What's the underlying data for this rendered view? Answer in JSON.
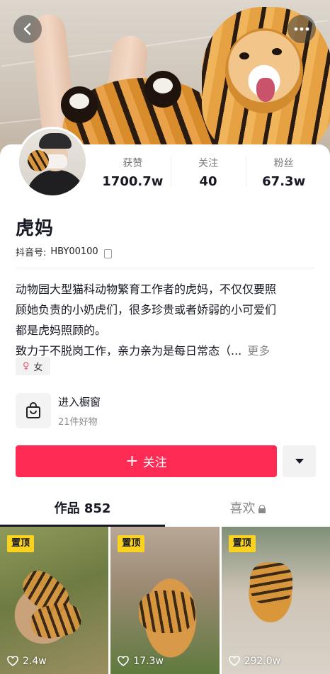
{
  "header": {
    "back_icon": "chevron-left-icon",
    "more_icon": "more-dots-icon"
  },
  "profile": {
    "name": "虎妈",
    "douyin_id_label": "抖音号:",
    "douyin_id": "HBY00100",
    "stats": [
      {
        "label": "获赞",
        "value": "1700.7w"
      },
      {
        "label": "关注",
        "value": "40"
      },
      {
        "label": "粉丝",
        "value": "67.3w"
      }
    ],
    "bio_lines": [
      "动物园大型猫科动物繁育工作者的虎妈，不仅仅要照",
      "顾她负责的小奶虎们，很多珍贵或者娇弱的小可爱们",
      "都是虎妈照顾的。",
      "致力于不脱岗工作，亲力亲为是每日常态（..."
    ],
    "bio_more": "更多",
    "gender_symbol": "♀",
    "gender": "女"
  },
  "shop": {
    "title": "进入橱窗",
    "subtitle": "21件好物"
  },
  "actions": {
    "follow_label": "关注",
    "follow_icon": "+",
    "accent_color": "#fe2c55"
  },
  "tabs": [
    {
      "label": "作品 852"
    },
    {
      "label": "喜欢"
    }
  ],
  "videos": [
    {
      "badge": "置顶",
      "likes": "2.4w"
    },
    {
      "badge": "置顶",
      "likes": "17.3w"
    },
    {
      "badge": "置顶",
      "likes": "292.0w"
    }
  ]
}
